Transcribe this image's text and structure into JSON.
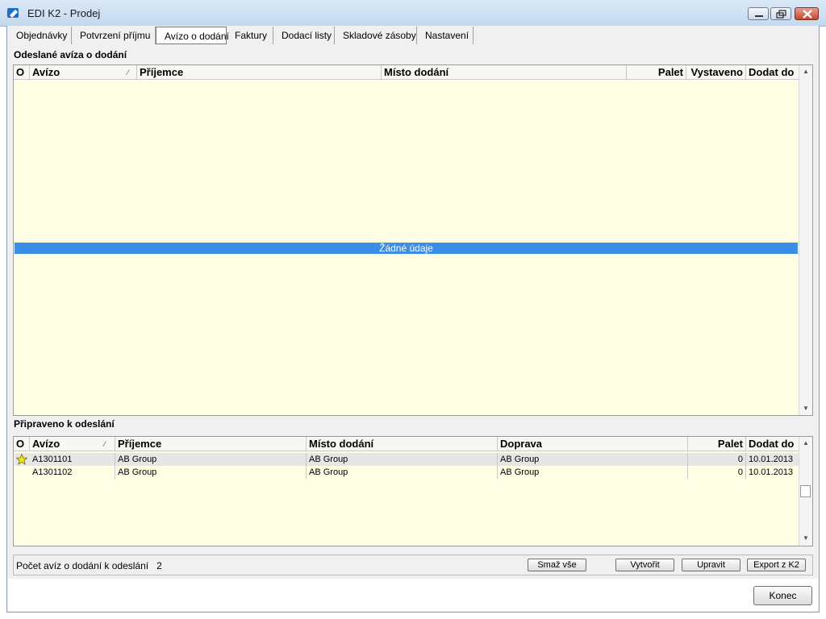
{
  "window": {
    "title": "EDI K2 - Prodej"
  },
  "tabs": [
    {
      "label": "Objednávky"
    },
    {
      "label": "Potvrzení příjmu"
    },
    {
      "label": "Avízo o dodání"
    },
    {
      "label": "Faktury"
    },
    {
      "label": "Dodací listy"
    },
    {
      "label": "Skladové zásoby"
    },
    {
      "label": "Nastavení"
    }
  ],
  "active_tab": "Avízo o dodání",
  "sent": {
    "section_title": "Odeslané avíza o dodání",
    "columns": [
      "O",
      "Avízo",
      "Příjemce",
      "Místo dodání",
      "Palet",
      "Vystaveno",
      "Dodat do"
    ],
    "sort_column": "Avízo",
    "empty_text": "Žádné údaje"
  },
  "ready": {
    "section_title": "Připraveno k odeslání",
    "columns": [
      "O",
      "Avízo",
      "Příjemce",
      "Místo dodání",
      "Doprava",
      "Palet",
      "Dodat do"
    ],
    "sort_column": "Avízo",
    "rows": [
      {
        "flag": "star-icon",
        "avizo": "A1301101",
        "prijemce": "AB Group",
        "misto": "AB Group",
        "doprava": "AB Group",
        "palet": "0",
        "dodat_do": "10.01.2013"
      },
      {
        "flag": "",
        "avizo": "A1301102",
        "prijemce": "AB Group",
        "misto": "AB Group",
        "doprava": "AB Group",
        "palet": "0",
        "dodat_do": "10.01.2013"
      }
    ]
  },
  "status": {
    "label": "Počet avíz o dodání k odeslání",
    "count": "2"
  },
  "buttons": {
    "delete_all": "Smaž vše",
    "create": "Vytvořit",
    "edit": "Upravit",
    "export": "Export z K2",
    "close": "Konec"
  },
  "colors": {
    "selection": "#3a8ee6",
    "grid_bg": "#ffffe6",
    "row_highlight": "#e6e6e6"
  }
}
